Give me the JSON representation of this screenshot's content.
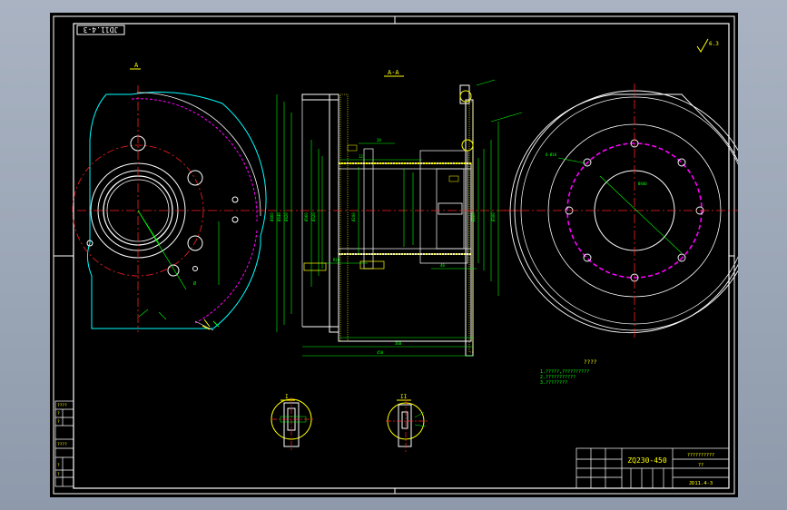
{
  "drawing": {
    "title_stamp": "JD11.4-3",
    "section_label": "A-A",
    "view_label_left": "A",
    "roughness_symbol": "6.3",
    "part_number": "ZQ230-450",
    "title_block_label": "??????????",
    "title_block_mark": "??",
    "title_block_code": "JD11.4-3",
    "detail_label_1": "I",
    "detail_label_2": "II",
    "notes_title": "????",
    "notes": [
      "1.?????,??????????",
      "2.???????????",
      "3.????????"
    ],
    "left_table_rows": [
      "????",
      "?",
      "?",
      "????",
      "?",
      "?"
    ]
  },
  "colors": {
    "background": "#000000",
    "border": "#ffffff",
    "geometry": "#ffffff",
    "cyan": "#00ffff",
    "centerline": "#ff2020",
    "dimension": "#00ff00",
    "hidden": "#ff00ff",
    "text": "#ffff00"
  }
}
